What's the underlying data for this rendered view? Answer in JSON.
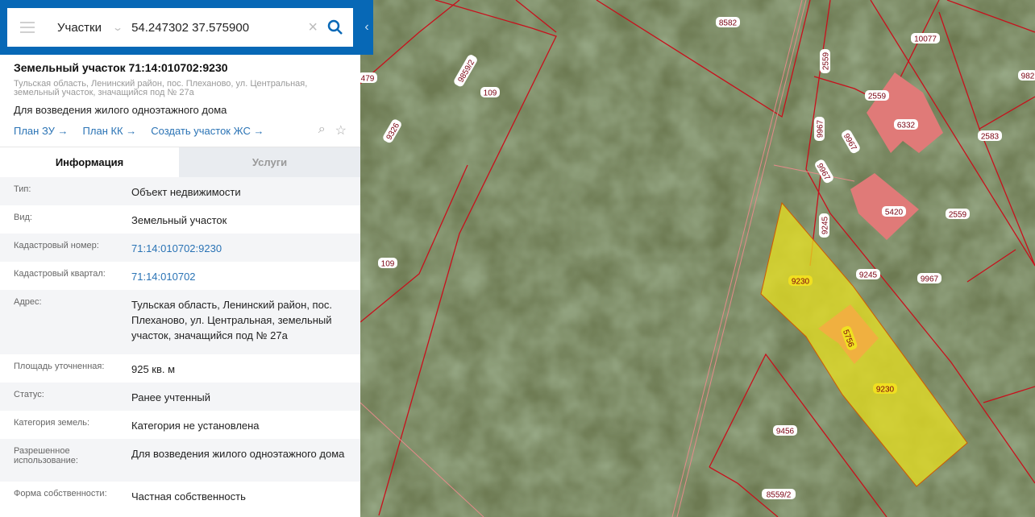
{
  "search": {
    "layer": "Участки",
    "query": "54.247302 37.575900"
  },
  "object": {
    "title": "Земельный участок 71:14:010702:9230",
    "address_line1": "Тульская область, Ленинский район, пос. Плеханово, ул. Центральная,",
    "address_line2": "земельный участок, значащийся под № 27а",
    "purpose": "Для возведения жилого одноэтажного дома",
    "links": [
      "План ЗУ →",
      "План КК →",
      "Создать участок ЖС →"
    ]
  },
  "tabs": [
    "Информация",
    "Услуги"
  ],
  "info": [
    {
      "k": "Тип:",
      "v": "Объект недвижимости"
    },
    {
      "k": "Вид:",
      "v": "Земельный участок"
    },
    {
      "k": "Кадастровый номер:",
      "v": "71:14:010702:9230",
      "link": true
    },
    {
      "k": "Кадастровый квартал:",
      "v": "71:14:010702",
      "link": true
    },
    {
      "k": "Адрес:",
      "v": "Тульская область, Ленинский район, пос. Плеханово, ул. Центральная, земельный участок, значащийся под № 27а"
    },
    {
      "k": "Площадь уточненная:",
      "v": "925 кв. м"
    },
    {
      "k": "Статус:",
      "v": "Ранее учтенный"
    },
    {
      "k": "Категория земель:",
      "v": "Категория не установлена"
    },
    {
      "k": "Разрешенное использование:",
      "v": "Для возведения жилого одноэтажного дома"
    },
    {
      "k": "Форма собственности:",
      "v": "Частная собственность"
    }
  ],
  "map_labels": [
    "8582",
    "10077",
    "982",
    "9859/2",
    "479",
    "109",
    "9326",
    "2559",
    "2559",
    "6332",
    "2583",
    "9967",
    "9967",
    "9967",
    "5420",
    "2559",
    "9245",
    "9245",
    "9967",
    "109",
    "9230",
    "5756",
    "9230",
    "9456",
    "8559/2"
  ],
  "colors": {
    "accent": "#0768b6",
    "selected": "#e8e020",
    "building": "#e07a78"
  }
}
